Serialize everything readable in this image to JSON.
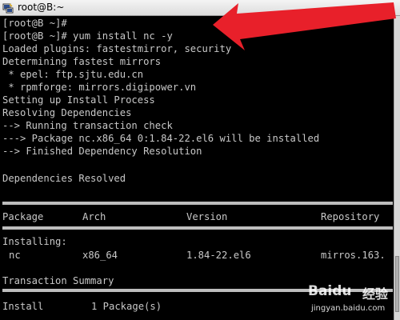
{
  "window": {
    "title": "root@B:~",
    "icon": "putty-terminal-icon"
  },
  "terminal": {
    "lines": [
      "[root@B ~]#",
      "[root@B ~]# yum install nc -y",
      "Loaded plugins: fastestmirror, security",
      "Determining fastest mirrors",
      " * epel: ftp.sjtu.edu.cn",
      " * rpmforge: mirrors.digipower.vn",
      "Setting up Install Process",
      "Resolving Dependencies",
      "--> Running transaction check",
      "---> Package nc.x86_64 0:1.84-22.el6 will be installed",
      "--> Finished Dependency Resolution",
      "",
      "Dependencies Resolved"
    ],
    "table": {
      "headers": [
        "Package",
        "Arch",
        "Version",
        "Repository"
      ],
      "installing_label": "Installing:",
      "row": [
        "nc",
        "x86_64",
        "1.84-22.el6",
        "mirros.163."
      ],
      "summary_label": "Transaction Summary",
      "install_line": [
        "Install",
        "1 Package(s)"
      ]
    }
  },
  "annotation": {
    "color": "#e8202a",
    "shape": "arrow"
  },
  "watermark": {
    "logo": "Baidu",
    "text": "经验",
    "url": "jingyan.baidu.com"
  }
}
